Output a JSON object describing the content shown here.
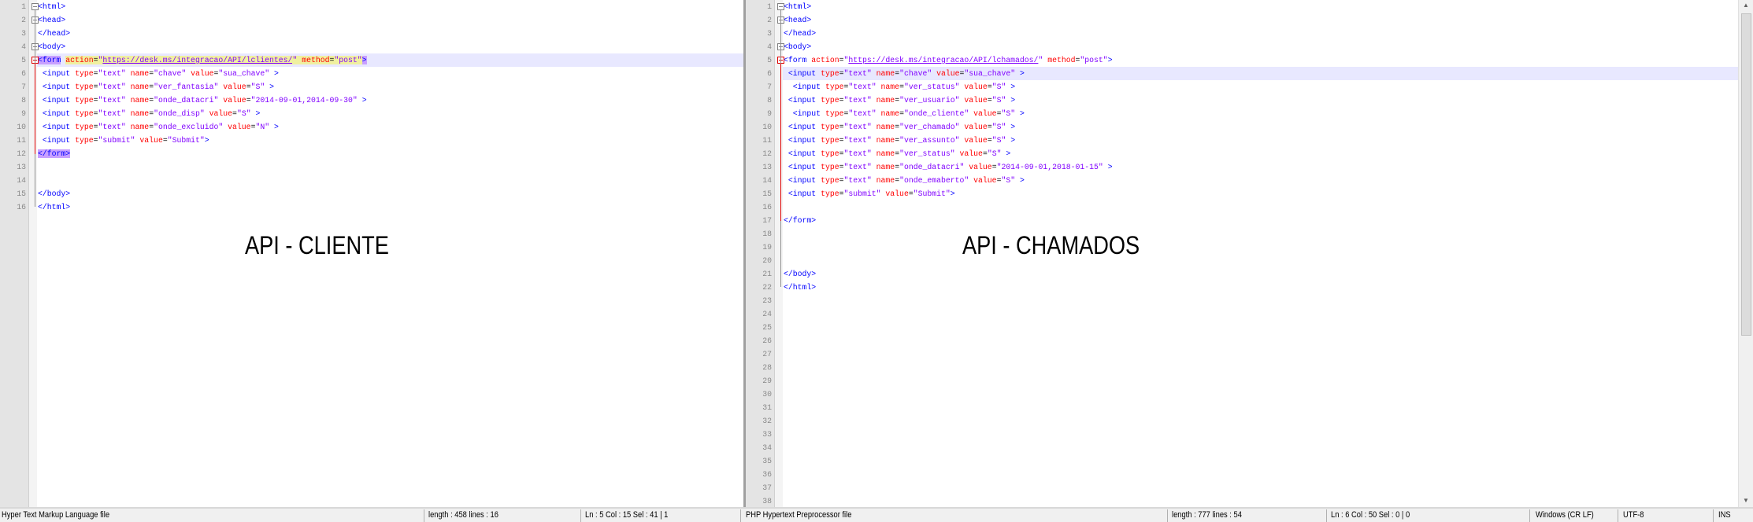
{
  "left_editor": {
    "line_count": 16,
    "current_line": 5,
    "lines": [
      [
        [
          "tag",
          "<html>"
        ]
      ],
      [
        [
          "tag",
          "<head>"
        ]
      ],
      [
        [
          "tag",
          "</head>"
        ]
      ],
      [
        [
          "tag",
          "<body>"
        ]
      ],
      [
        [
          "tag",
          "<form"
        ],
        [
          "sp",
          " "
        ],
        [
          "attr",
          "action"
        ],
        [
          "eq",
          "="
        ],
        [
          "val",
          "\""
        ],
        [
          "url",
          "https://desk.ms/integracao/API/lclientes/"
        ],
        [
          "val",
          "\""
        ],
        [
          "sp",
          " "
        ],
        [
          "attr",
          "method"
        ],
        [
          "eq",
          "="
        ],
        [
          "val",
          "\"post\""
        ],
        [
          "tag",
          ">"
        ]
      ],
      [
        [
          "sp",
          " "
        ],
        [
          "tag",
          "<input"
        ],
        [
          "sp",
          " "
        ],
        [
          "attr",
          "type"
        ],
        [
          "eq",
          "="
        ],
        [
          "val",
          "\"text\""
        ],
        [
          "sp",
          " "
        ],
        [
          "attr",
          "name"
        ],
        [
          "eq",
          "="
        ],
        [
          "val",
          "\"chave\""
        ],
        [
          "sp",
          " "
        ],
        [
          "attr",
          "value"
        ],
        [
          "eq",
          "="
        ],
        [
          "val",
          "\"sua_chave\""
        ],
        [
          "sp",
          " "
        ],
        [
          "tag",
          ">"
        ]
      ],
      [
        [
          "sp",
          " "
        ],
        [
          "tag",
          "<input"
        ],
        [
          "sp",
          " "
        ],
        [
          "attr",
          "type"
        ],
        [
          "eq",
          "="
        ],
        [
          "val",
          "\"text\""
        ],
        [
          "sp",
          " "
        ],
        [
          "attr",
          "name"
        ],
        [
          "eq",
          "="
        ],
        [
          "val",
          "\"ver_fantasia\""
        ],
        [
          "sp",
          " "
        ],
        [
          "attr",
          "value"
        ],
        [
          "eq",
          "="
        ],
        [
          "val",
          "\"S\""
        ],
        [
          "sp",
          " "
        ],
        [
          "tag",
          ">"
        ]
      ],
      [
        [
          "sp",
          " "
        ],
        [
          "tag",
          "<input"
        ],
        [
          "sp",
          " "
        ],
        [
          "attr",
          "type"
        ],
        [
          "eq",
          "="
        ],
        [
          "val",
          "\"text\""
        ],
        [
          "sp",
          " "
        ],
        [
          "attr",
          "name"
        ],
        [
          "eq",
          "="
        ],
        [
          "val",
          "\"onde_datacri\""
        ],
        [
          "sp",
          " "
        ],
        [
          "attr",
          "value"
        ],
        [
          "eq",
          "="
        ],
        [
          "val",
          "\"2014-09-01,2014-09-30\""
        ],
        [
          "sp",
          " "
        ],
        [
          "tag",
          ">"
        ]
      ],
      [
        [
          "sp",
          " "
        ],
        [
          "tag",
          "<input"
        ],
        [
          "sp",
          " "
        ],
        [
          "attr",
          "type"
        ],
        [
          "eq",
          "="
        ],
        [
          "val",
          "\"text\""
        ],
        [
          "sp",
          " "
        ],
        [
          "attr",
          "name"
        ],
        [
          "eq",
          "="
        ],
        [
          "val",
          "\"onde_disp\""
        ],
        [
          "sp",
          " "
        ],
        [
          "attr",
          "value"
        ],
        [
          "eq",
          "="
        ],
        [
          "val",
          "\"S\""
        ],
        [
          "sp",
          " "
        ],
        [
          "tag",
          ">"
        ]
      ],
      [
        [
          "sp",
          " "
        ],
        [
          "tag",
          "<input"
        ],
        [
          "sp",
          " "
        ],
        [
          "attr",
          "type"
        ],
        [
          "eq",
          "="
        ],
        [
          "val",
          "\"text\""
        ],
        [
          "sp",
          " "
        ],
        [
          "attr",
          "name"
        ],
        [
          "eq",
          "="
        ],
        [
          "val",
          "\"onde_excluido\""
        ],
        [
          "sp",
          " "
        ],
        [
          "attr",
          "value"
        ],
        [
          "eq",
          "="
        ],
        [
          "val",
          "\"N\""
        ],
        [
          "sp",
          " "
        ],
        [
          "tag",
          ">"
        ]
      ],
      [
        [
          "sp",
          " "
        ],
        [
          "tag",
          "<input"
        ],
        [
          "sp",
          " "
        ],
        [
          "attr",
          "type"
        ],
        [
          "eq",
          "="
        ],
        [
          "val",
          "\"submit\""
        ],
        [
          "sp",
          " "
        ],
        [
          "attr",
          "value"
        ],
        [
          "eq",
          "="
        ],
        [
          "val",
          "\"Submit\""
        ],
        [
          "tag",
          ">"
        ]
      ],
      [
        [
          "tag",
          "</form>"
        ]
      ],
      [],
      [],
      [
        [
          "tag",
          "</body>"
        ]
      ],
      [
        [
          "tag",
          "</html>"
        ]
      ]
    ],
    "overlay_label": "API - CLIENTE"
  },
  "right_editor": {
    "line_count": 38,
    "current_line": 6,
    "lines": [
      [
        [
          "tag",
          "<html>"
        ]
      ],
      [
        [
          "tag",
          "<head>"
        ]
      ],
      [
        [
          "tag",
          "</head>"
        ]
      ],
      [
        [
          "tag",
          "<body>"
        ]
      ],
      [
        [
          "tag",
          "<form"
        ],
        [
          "sp",
          " "
        ],
        [
          "attr",
          "action"
        ],
        [
          "eq",
          "="
        ],
        [
          "val",
          "\""
        ],
        [
          "url",
          "https://desk.ms/integracao/API/lchamados/"
        ],
        [
          "val",
          "\""
        ],
        [
          "sp",
          " "
        ],
        [
          "attr",
          "method"
        ],
        [
          "eq",
          "="
        ],
        [
          "val",
          "\"post\""
        ],
        [
          "tag",
          ">"
        ]
      ],
      [
        [
          "sp",
          " "
        ],
        [
          "tag",
          "<input"
        ],
        [
          "sp",
          " "
        ],
        [
          "attr",
          "type"
        ],
        [
          "eq",
          "="
        ],
        [
          "val",
          "\"text\""
        ],
        [
          "sp",
          " "
        ],
        [
          "attr",
          "name"
        ],
        [
          "eq",
          "="
        ],
        [
          "val",
          "\"chave\""
        ],
        [
          "sp",
          " "
        ],
        [
          "attr",
          "value"
        ],
        [
          "eq",
          "="
        ],
        [
          "val",
          "\"sua_chave\""
        ],
        [
          "sp",
          " "
        ],
        [
          "tag",
          ">"
        ]
      ],
      [
        [
          "sp",
          "  "
        ],
        [
          "tag",
          "<input"
        ],
        [
          "sp",
          " "
        ],
        [
          "attr",
          "type"
        ],
        [
          "eq",
          "="
        ],
        [
          "val",
          "\"text\""
        ],
        [
          "sp",
          " "
        ],
        [
          "attr",
          "name"
        ],
        [
          "eq",
          "="
        ],
        [
          "val",
          "\"ver_status\""
        ],
        [
          "sp",
          " "
        ],
        [
          "attr",
          "value"
        ],
        [
          "eq",
          "="
        ],
        [
          "val",
          "\"S\""
        ],
        [
          "sp",
          " "
        ],
        [
          "tag",
          ">"
        ]
      ],
      [
        [
          "sp",
          " "
        ],
        [
          "tag",
          "<input"
        ],
        [
          "sp",
          " "
        ],
        [
          "attr",
          "type"
        ],
        [
          "eq",
          "="
        ],
        [
          "val",
          "\"text\""
        ],
        [
          "sp",
          " "
        ],
        [
          "attr",
          "name"
        ],
        [
          "eq",
          "="
        ],
        [
          "val",
          "\"ver_usuario\""
        ],
        [
          "sp",
          " "
        ],
        [
          "attr",
          "value"
        ],
        [
          "eq",
          "="
        ],
        [
          "val",
          "\"S\""
        ],
        [
          "sp",
          " "
        ],
        [
          "tag",
          ">"
        ]
      ],
      [
        [
          "sp",
          "  "
        ],
        [
          "tag",
          "<input"
        ],
        [
          "sp",
          " "
        ],
        [
          "attr",
          "type"
        ],
        [
          "eq",
          "="
        ],
        [
          "val",
          "\"text\""
        ],
        [
          "sp",
          " "
        ],
        [
          "attr",
          "name"
        ],
        [
          "eq",
          "="
        ],
        [
          "val",
          "\"onde_cliente\""
        ],
        [
          "sp",
          " "
        ],
        [
          "attr",
          "value"
        ],
        [
          "eq",
          "="
        ],
        [
          "val",
          "\"S\""
        ],
        [
          "sp",
          " "
        ],
        [
          "tag",
          ">"
        ]
      ],
      [
        [
          "sp",
          " "
        ],
        [
          "tag",
          "<input"
        ],
        [
          "sp",
          " "
        ],
        [
          "attr",
          "type"
        ],
        [
          "eq",
          "="
        ],
        [
          "val",
          "\"text\""
        ],
        [
          "sp",
          " "
        ],
        [
          "attr",
          "name"
        ],
        [
          "eq",
          "="
        ],
        [
          "val",
          "\"ver_chamado\""
        ],
        [
          "sp",
          " "
        ],
        [
          "attr",
          "value"
        ],
        [
          "eq",
          "="
        ],
        [
          "val",
          "\"S\""
        ],
        [
          "sp",
          " "
        ],
        [
          "tag",
          ">"
        ]
      ],
      [
        [
          "sp",
          " "
        ],
        [
          "tag",
          "<input"
        ],
        [
          "sp",
          " "
        ],
        [
          "attr",
          "type"
        ],
        [
          "eq",
          "="
        ],
        [
          "val",
          "\"text\""
        ],
        [
          "sp",
          " "
        ],
        [
          "attr",
          "name"
        ],
        [
          "eq",
          "="
        ],
        [
          "val",
          "\"ver_assunto\""
        ],
        [
          "sp",
          " "
        ],
        [
          "attr",
          "value"
        ],
        [
          "eq",
          "="
        ],
        [
          "val",
          "\"S\""
        ],
        [
          "sp",
          " "
        ],
        [
          "tag",
          ">"
        ]
      ],
      [
        [
          "sp",
          " "
        ],
        [
          "tag",
          "<input"
        ],
        [
          "sp",
          " "
        ],
        [
          "attr",
          "type"
        ],
        [
          "eq",
          "="
        ],
        [
          "val",
          "\"text\""
        ],
        [
          "sp",
          " "
        ],
        [
          "attr",
          "name"
        ],
        [
          "eq",
          "="
        ],
        [
          "val",
          "\"ver_status\""
        ],
        [
          "sp",
          " "
        ],
        [
          "attr",
          "value"
        ],
        [
          "eq",
          "="
        ],
        [
          "val",
          "\"S\""
        ],
        [
          "sp",
          " "
        ],
        [
          "tag",
          ">"
        ]
      ],
      [
        [
          "sp",
          " "
        ],
        [
          "tag",
          "<input"
        ],
        [
          "sp",
          " "
        ],
        [
          "attr",
          "type"
        ],
        [
          "eq",
          "="
        ],
        [
          "val",
          "\"text\""
        ],
        [
          "sp",
          " "
        ],
        [
          "attr",
          "name"
        ],
        [
          "eq",
          "="
        ],
        [
          "val",
          "\"onde_datacri\""
        ],
        [
          "sp",
          " "
        ],
        [
          "attr",
          "value"
        ],
        [
          "eq",
          "="
        ],
        [
          "val",
          "\"2014-09-01,2018-01-15\""
        ],
        [
          "sp",
          " "
        ],
        [
          "tag",
          ">"
        ]
      ],
      [
        [
          "sp",
          " "
        ],
        [
          "tag",
          "<input"
        ],
        [
          "sp",
          " "
        ],
        [
          "attr",
          "type"
        ],
        [
          "eq",
          "="
        ],
        [
          "val",
          "\"text\""
        ],
        [
          "sp",
          " "
        ],
        [
          "attr",
          "name"
        ],
        [
          "eq",
          "="
        ],
        [
          "val",
          "\"onde_emaberto\""
        ],
        [
          "sp",
          " "
        ],
        [
          "attr",
          "value"
        ],
        [
          "eq",
          "="
        ],
        [
          "val",
          "\"S\""
        ],
        [
          "sp",
          " "
        ],
        [
          "tag",
          ">"
        ]
      ],
      [
        [
          "sp",
          " "
        ],
        [
          "tag",
          "<input"
        ],
        [
          "sp",
          " "
        ],
        [
          "attr",
          "type"
        ],
        [
          "eq",
          "="
        ],
        [
          "val",
          "\"submit\""
        ],
        [
          "sp",
          " "
        ],
        [
          "attr",
          "value"
        ],
        [
          "eq",
          "="
        ],
        [
          "val",
          "\"Submit\""
        ],
        [
          "tag",
          ">"
        ]
      ],
      [],
      [
        [
          "tag",
          "</form>"
        ]
      ],
      [],
      [],
      [],
      [
        [
          "tag",
          "</body>"
        ]
      ],
      [
        [
          "tag",
          "</html>"
        ]
      ]
    ],
    "overlay_label": "API - CHAMADOS"
  },
  "status_left": {
    "file_type": "Hyper Text Markup Language file",
    "length_lines": "length : 458    lines : 16",
    "position": "Ln : 5    Col : 15    Sel : 41 | 1"
  },
  "status_right": {
    "file_type": "PHP Hypertext Preprocessor file",
    "length_lines": "length : 777    lines : 54",
    "position": "Ln : 6    Col : 50    Sel : 0 | 0",
    "eol": "Windows (CR LF)",
    "encoding": "UTF-8",
    "mode": "INS"
  }
}
